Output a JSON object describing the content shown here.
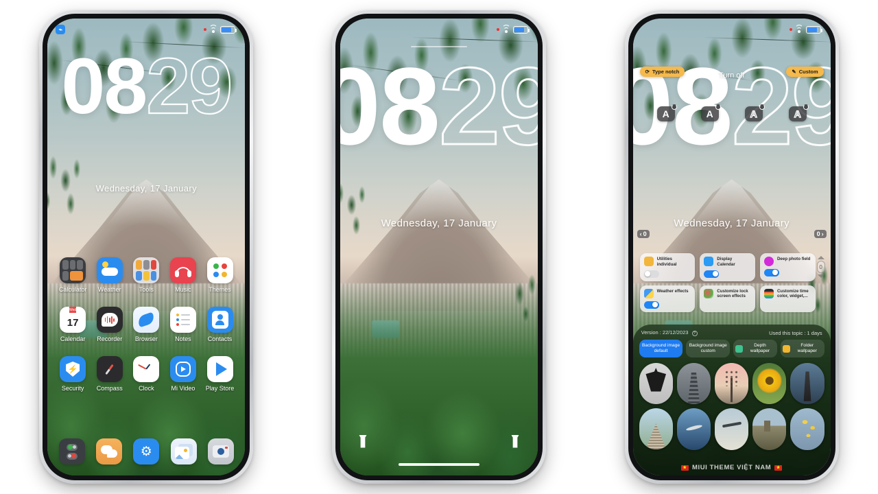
{
  "page": {
    "background_color": "#ffffff"
  },
  "clock": {
    "hours": "08",
    "minutes": "29",
    "date": "Wednesday, 17 January"
  },
  "statusbar": {
    "bluetooth_icon": "bluetooth-icon",
    "wifi_icon": "wifi-icon",
    "battery_icon": "battery-icon"
  },
  "phone1": {
    "label": "home-screen",
    "apps": [
      {
        "name": "Calculator",
        "icon": "calculator-icon"
      },
      {
        "name": "Weather",
        "icon": "weather-icon"
      },
      {
        "name": "Tools",
        "icon": "tools-folder-icon"
      },
      {
        "name": "Music",
        "icon": "music-icon"
      },
      {
        "name": "Themes",
        "icon": "themes-icon"
      },
      {
        "name": "Calendar",
        "icon": "calendar-icon"
      },
      {
        "name": "Recorder",
        "icon": "recorder-icon"
      },
      {
        "name": "Browser",
        "icon": "browser-icon"
      },
      {
        "name": "Notes",
        "icon": "notes-icon"
      },
      {
        "name": "Contacts",
        "icon": "contacts-icon"
      },
      {
        "name": "Security",
        "icon": "security-icon"
      },
      {
        "name": "Compass",
        "icon": "compass-icon"
      },
      {
        "name": "Clock",
        "icon": "clock-icon"
      },
      {
        "name": "Mi Video",
        "icon": "mi-video-icon"
      },
      {
        "name": "Play Store",
        "icon": "play-store-icon"
      }
    ],
    "calendar_day": "17",
    "calendar_weekday": "Wed",
    "dock": [
      {
        "name": "Phone",
        "icon": "phone-icon"
      },
      {
        "name": "Messages",
        "icon": "messages-icon"
      },
      {
        "name": "Settings",
        "icon": "settings-gear-icon"
      },
      {
        "name": "Gallery",
        "icon": "gallery-icon"
      },
      {
        "name": "Camera",
        "icon": "camera-icon"
      }
    ]
  },
  "phone2": {
    "label": "lock-screen",
    "shortcut_left": "flashlight-icon",
    "shortcut_right": "camera-icon",
    "home_indicator": "home-indicator"
  },
  "phone3": {
    "label": "theme-editor",
    "top_left_button": "Type notch",
    "top_left_icon": "refresh-icon",
    "top_center_label": "Turn off",
    "top_right_button": "Custom",
    "top_right_icon": "pencil-icon",
    "font_handles": [
      {
        "glyph": "A",
        "style": "solid"
      },
      {
        "glyph": "A",
        "style": "solid"
      },
      {
        "glyph": "A",
        "style": "outline"
      },
      {
        "glyph": "A",
        "style": "outline"
      }
    ],
    "badge_left": "0",
    "badge_left_arrow": "‹",
    "badge_right": "0",
    "badge_right_arrow": "›",
    "stepper_value": "0",
    "options": [
      {
        "title": "Utilities individual",
        "toggle": "off",
        "icon": "utilities-icon",
        "color": "#f2b63c"
      },
      {
        "title": "Display Calendar",
        "toggle": "on",
        "icon": "calendar-display-icon",
        "color": "#2b9bf4"
      },
      {
        "title": "Deep photo field",
        "toggle": "on",
        "icon": "depth-icon",
        "color": "#d32ad9"
      },
      {
        "title": "Weather effects",
        "toggle": "on",
        "icon": "weather-effects-icon",
        "color": "#3f9bf5"
      },
      {
        "title": "Customize lock screen effects",
        "toggle": "none",
        "icon": "lockscreen-effects-icon",
        "color": "#ffffff"
      },
      {
        "title": "Customize time color, widget,...",
        "toggle": "none",
        "icon": "time-color-icon",
        "color": "#2c2c2e"
      }
    ],
    "sheet": {
      "version_label": "Version : 22/12/2023",
      "help_icon": "help-icon",
      "used_label": "Used this topic : 1 days",
      "chips": [
        {
          "label": "Background image default",
          "active": true,
          "icon": null
        },
        {
          "label": "Background image custom",
          "active": false,
          "icon": null
        },
        {
          "label": "Depth wallpaper",
          "active": false,
          "icon": "download-icon"
        },
        {
          "label": "Folder wallpaper",
          "active": false,
          "icon": "folder-icon"
        }
      ],
      "thumbnails": [
        {
          "name": "christ-statue-thumbnail"
        },
        {
          "name": "tower-thumbnail"
        },
        {
          "name": "bare-tree-sunset-thumbnail"
        },
        {
          "name": "sunflower-thumbnail"
        },
        {
          "name": "lighthouse-thumbnail"
        },
        {
          "name": "monument-thumbnail"
        },
        {
          "name": "eagle-thumbnail"
        },
        {
          "name": "airplane-thumbnail"
        },
        {
          "name": "coastal-town-thumbnail"
        },
        {
          "name": "yellow-branch-thumbnail"
        }
      ],
      "watermark": "MIUI THEME VIỆT NAM",
      "watermark_flag": "vietnam-flag-icon"
    }
  }
}
